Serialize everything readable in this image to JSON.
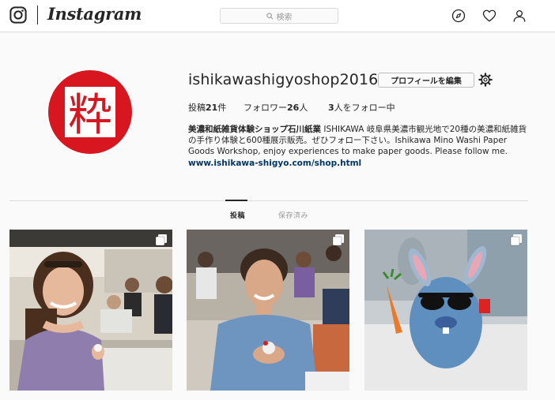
{
  "nav": {
    "logo_text": "Instagram",
    "search_placeholder": "検索",
    "icons": [
      "instagram-glyph-icon",
      "explore-compass-icon",
      "activity-heart-icon",
      "profile-person-icon"
    ]
  },
  "profile": {
    "username": "ishikawashigyoshop2016",
    "edit_button": "プロフィールを編集",
    "avatar_text": "粋",
    "stats": {
      "posts_label": "投稿",
      "posts_count": "21",
      "posts_unit": "件",
      "followers_label": "フォロワー",
      "followers_count": "26",
      "followers_unit": "人",
      "following_count": "3",
      "following_label": "人をフォロー中"
    },
    "bio": {
      "name": "美濃和紙雑貨体験ショップ石川紙業",
      "text": "ISHIKAWA 岐阜県美濃市観光地で20種の美濃和紙雑貨の手作り体験と600種展示販売。ぜひフォロー下さい。Ishikawa Mino Washi Paper Goods Workshop, enjoy experiences to make paper goods. Please follow me.",
      "link": "www.ishikawa-shigyo.com/shop.html"
    }
  },
  "tabs": [
    {
      "label": "投稿",
      "active": true
    },
    {
      "label": "保存済み",
      "active": false
    }
  ],
  "colors": {
    "avatar_red": "#d7161f",
    "link": "#003569",
    "border": "#dbdbdb"
  }
}
